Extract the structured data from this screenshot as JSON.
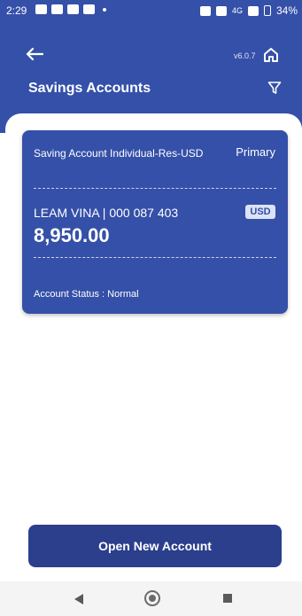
{
  "status_bar": {
    "time": "2:29",
    "network": "4G",
    "battery": "34%",
    "left_icons": [
      "image-notification-icon",
      "facebook-icon",
      "message-icon",
      "youtube-icon"
    ],
    "right_icons": [
      "vibrate-icon",
      "wifi-icon",
      "signal-icon",
      "battery-icon"
    ]
  },
  "app_bar": {
    "version": "v6.0.7",
    "title": "Savings Accounts",
    "icons": {
      "back": "arrow-left-icon",
      "home": "home-icon",
      "filter": "filter-icon"
    }
  },
  "account": {
    "type": "Saving Account Individual-Res-USD",
    "tag": "Primary",
    "holder": "LEAM VINA | 000 087 403",
    "currency": "USD",
    "balance": "8,950.00",
    "status": "Account Status : Normal"
  },
  "actions": {
    "open_new_account": "Open New Account"
  },
  "colors": {
    "primary": "#3550a8",
    "button": "#2b3f8c",
    "badge_bg": "#dbe3f5",
    "background": "#ffffff"
  }
}
